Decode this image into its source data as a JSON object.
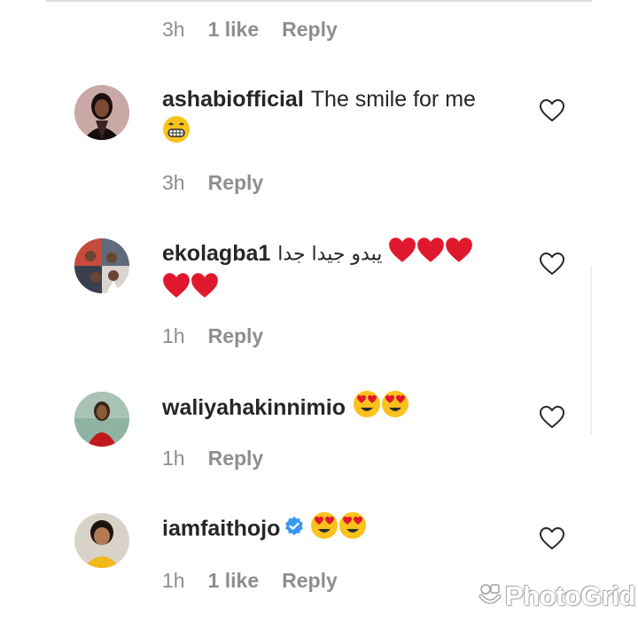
{
  "top_meta": {
    "time": "3h",
    "likes": "1 like",
    "reply": "Reply"
  },
  "comments": [
    {
      "username": "ashabiofficial",
      "text": "The smile for me",
      "emoji": "grinning-face",
      "time": "3h",
      "reply": "Reply"
    },
    {
      "username": "ekolagba1",
      "text": "يبدو جيدا جدا",
      "emoji": "red-heart x5",
      "time": "1h",
      "reply": "Reply"
    },
    {
      "username": "waliyahakinnimio",
      "text": "",
      "emoji": "heart-eyes x2",
      "time": "1h",
      "reply": "Reply"
    },
    {
      "username": "iamfaithojo",
      "text": "",
      "emoji": "heart-eyes x2",
      "verified": true,
      "time": "1h",
      "likes": "1 like",
      "reply": "Reply"
    }
  ],
  "watermark": {
    "text": "PhotoGrid"
  },
  "colors": {
    "meta_gray": "#8e8e8e",
    "text": "#262626",
    "verified_blue": "#3897f0",
    "heart_red": "#e0182d"
  }
}
